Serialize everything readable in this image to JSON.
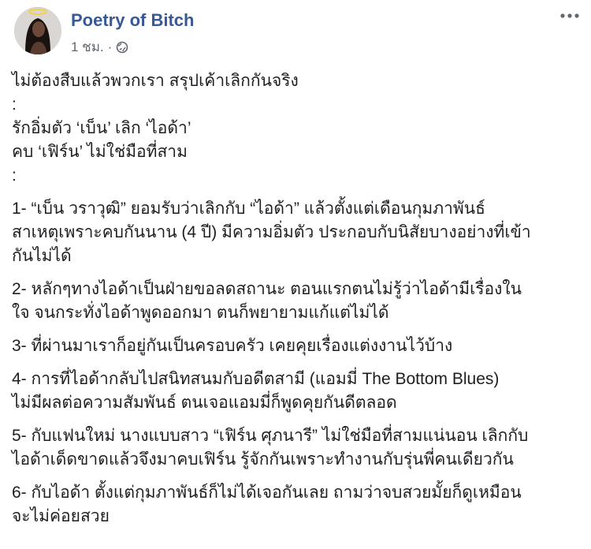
{
  "post": {
    "author": "Poetry of Bitch",
    "time": "1 ชม.",
    "separator": "·",
    "intro_lines": [
      "ไม่ต้องสืบแล้วพวกเรา สรุปเค้าเลิกกันจริง",
      ":",
      "รักอิ่มตัว ‘เบ็น’ เลิก ‘ไอด้า’",
      "คบ ‘เฟิร์น’ ไม่ใช่มือที่สาม",
      ":"
    ],
    "points": [
      [
        "1- “เบ็น วราวุฒิ” ยอมรับว่าเลิกกับ “ไอด้า” แล้วตั้งแต่เดือนกุมภาพันธ์",
        "สาเหตุเพราะคบกันนาน (4 ปี) มีความอิ่มตัว ประกอบกับนิสัยบางอย่างที่เข้า",
        "กันไม่ได้"
      ],
      [
        "2- หลักๆทางไอด้าเป็นฝ่ายขอลดสถานะ ตอนแรกตนไม่รู้ว่าไอด้ามีเรื่องใน",
        "ใจ จนกระทั่งไอด้าพูดออกมา ตนก็พยายามแก้แต่ไม่ได้"
      ],
      [
        "3- ที่ผ่านมาเราก็อยู่กันเป็นครอบครัว เคยคุยเรื่องแต่งงานไว้บ้าง"
      ],
      [
        "4- การที่ไอด้ากลับไปสนิทสนมกับอดีตสามี (แอมมี่ The Bottom Blues)",
        "ไม่มีผลต่อความสัมพันธ์ ตนเจอแอมมี่ก็พูดคุยกันดีตลอด"
      ],
      [
        "5- กับแฟนใหม่ นางแบบสาว “เฟิร์น ศุภนารี” ไม่ใช่มือที่สามแน่นอน เลิกกับ",
        "ไอด้าเด็ดขาดแล้วจึงมาคบเฟิร์น รู้จักกันเพราะทำงานกับรุ่นพี่คนเดียวกัน"
      ],
      [
        "6- กับไอด้า ตั้งแต่กุมภาพันธ์ก็ไม่ได้เจอกันเลย ถามว่าจบสวยมั้ยก็ดูเหมือน",
        "จะไม่ค่อยสวย"
      ]
    ]
  },
  "icons": {
    "globe": "globe-icon",
    "more": "more-horizontal-icon",
    "avatar": "profile-avatar"
  },
  "colors": {
    "author": "#385898",
    "meta": "#606770",
    "text": "#1c1e21"
  }
}
